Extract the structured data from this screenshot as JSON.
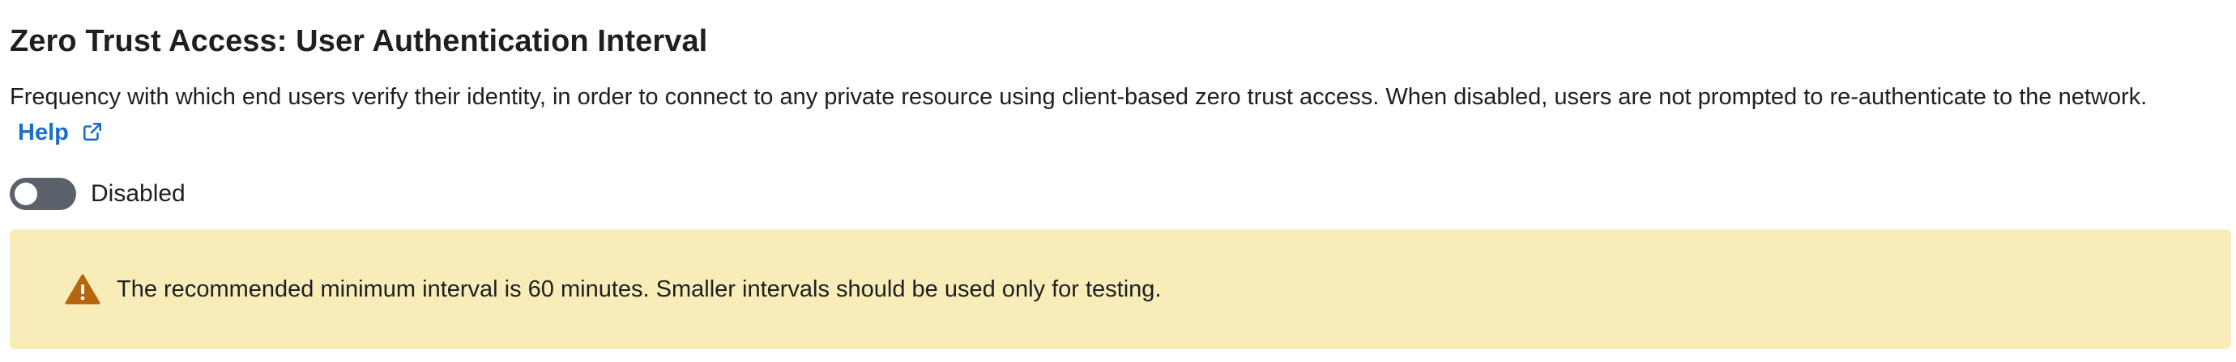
{
  "setting": {
    "title": "Zero Trust Access: User Authentication Interval",
    "description": "Frequency with which end users verify their identity, in order to connect to any private resource using client-based zero trust access. When disabled, users are not prompted to re-authenticate to the network.",
    "help_label": "Help",
    "help_icon": "external-link-icon"
  },
  "toggle": {
    "state": "off",
    "label": "Disabled"
  },
  "warning": {
    "icon": "warning-triangle-icon",
    "text": "The recommended minimum interval is 60 minutes. Smaller intervals should be used only for testing."
  },
  "colors": {
    "link": "#1a6fc9",
    "toggle_off": "#5b616b",
    "warning_bg": "#f8edb8",
    "warning_icon": "#b5650d"
  }
}
